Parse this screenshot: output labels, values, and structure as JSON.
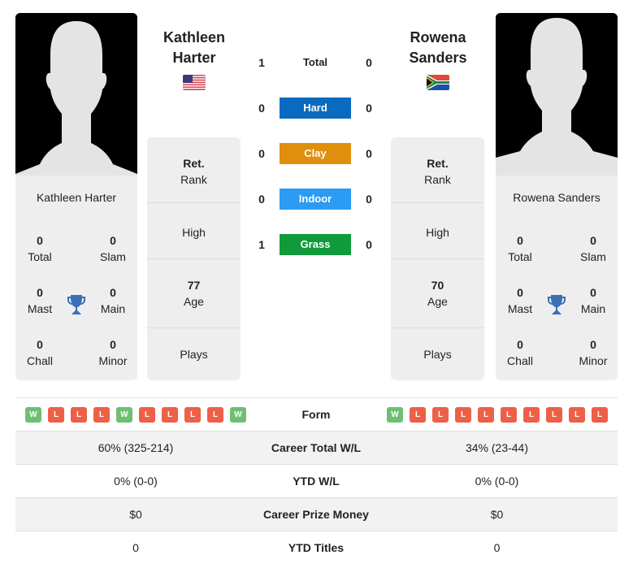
{
  "player_left": {
    "name_header_line1": "Kathleen",
    "name_header_line2": "Harter",
    "card_name": "Kathleen Harter",
    "flag": "usa-flag",
    "titles": {
      "total": {
        "value": "0",
        "label": "Total"
      },
      "slam": {
        "value": "0",
        "label": "Slam"
      },
      "mast": {
        "value": "0",
        "label": "Mast"
      },
      "main": {
        "value": "0",
        "label": "Main"
      },
      "chall": {
        "value": "0",
        "label": "Chall"
      },
      "minor": {
        "value": "0",
        "label": "Minor"
      }
    },
    "rank": {
      "value": "Ret.",
      "label": "Rank"
    },
    "high": {
      "label": "High"
    },
    "age": {
      "value": "77",
      "label": "Age"
    },
    "plays": {
      "label": "Plays"
    },
    "form": [
      "W",
      "L",
      "L",
      "L",
      "W",
      "L",
      "L",
      "L",
      "L",
      "W"
    ]
  },
  "player_right": {
    "name_header_line1": "Rowena",
    "name_header_line2": "Sanders",
    "card_name": "Rowena Sanders",
    "flag": "south-africa-flag",
    "titles": {
      "total": {
        "value": "0",
        "label": "Total"
      },
      "slam": {
        "value": "0",
        "label": "Slam"
      },
      "mast": {
        "value": "0",
        "label": "Mast"
      },
      "main": {
        "value": "0",
        "label": "Main"
      },
      "chall": {
        "value": "0",
        "label": "Chall"
      },
      "minor": {
        "value": "0",
        "label": "Minor"
      }
    },
    "rank": {
      "value": "Ret.",
      "label": "Rank"
    },
    "high": {
      "label": "High"
    },
    "age": {
      "value": "70",
      "label": "Age"
    },
    "plays": {
      "label": "Plays"
    },
    "form": [
      "W",
      "L",
      "L",
      "L",
      "L",
      "L",
      "L",
      "L",
      "L",
      "L"
    ]
  },
  "h2h": {
    "total": {
      "label": "Total",
      "left": "1",
      "right": "0"
    },
    "surfaces": [
      {
        "label": "Hard",
        "left": "0",
        "right": "0",
        "color": "#0a6abf"
      },
      {
        "label": "Clay",
        "left": "0",
        "right": "0",
        "color": "#df8f0c"
      },
      {
        "label": "Indoor",
        "left": "0",
        "right": "0",
        "color": "#2b9bf4"
      },
      {
        "label": "Grass",
        "left": "1",
        "right": "0",
        "color": "#119a3b"
      }
    ]
  },
  "stats": {
    "form_label": "Form",
    "rows": [
      {
        "label": "Career Total W/L",
        "left": "60% (325-214)",
        "right": "34% (23-44)"
      },
      {
        "label": "YTD W/L",
        "left": "0% (0-0)",
        "right": "0% (0-0)"
      },
      {
        "label": "Career Prize Money",
        "left": "$0",
        "right": "$0"
      },
      {
        "label": "YTD Titles",
        "left": "0",
        "right": "0"
      }
    ]
  },
  "colors": {
    "win": "#6fbf73",
    "loss": "#ee5f48",
    "trophy": "#3a6fb5"
  }
}
